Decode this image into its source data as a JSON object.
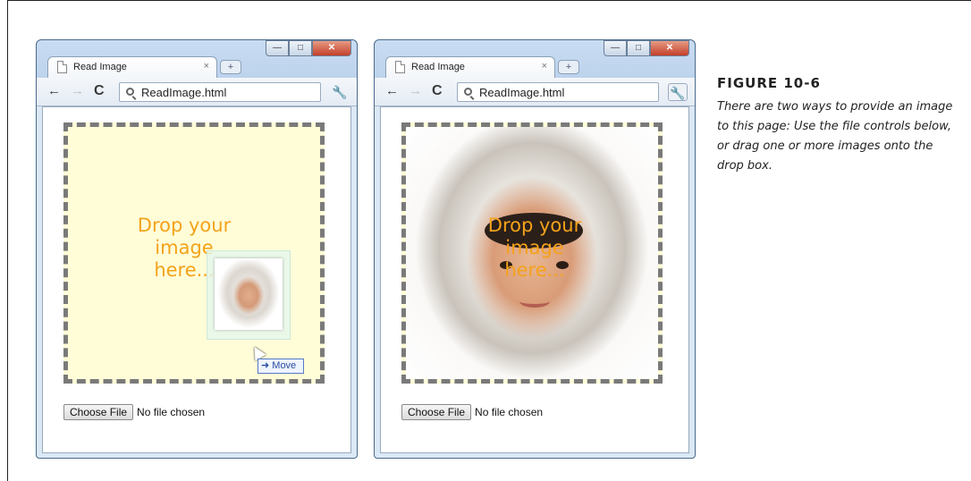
{
  "figure": {
    "label": "FIGURE 10-6",
    "caption": "There are two ways to provide an image to this page: Use the file controls below, or drag one or more images onto the drop box."
  },
  "windows": [
    {
      "tab_title": "Read Image",
      "tab_close": "×",
      "new_tab": "+",
      "address": "ReadImage.html",
      "drop_text": "Drop your\nimage\nhere...",
      "drag_badge": "Move",
      "choose_button": "Choose File",
      "file_status": "No file chosen"
    },
    {
      "tab_title": "Read Image",
      "tab_close": "×",
      "new_tab": "+",
      "address": "ReadImage.html",
      "drop_text": "Drop your\nimage\nhere...",
      "choose_button": "Choose File",
      "file_status": "No file chosen"
    }
  ],
  "icons": {
    "back": "back-arrow-icon",
    "forward": "forward-arrow-icon",
    "reload": "reload-icon",
    "search": "search-icon",
    "wrench": "wrench-icon"
  },
  "colors": {
    "drop_text": "#f4a21a",
    "dropbox_bg": "#fffdd8",
    "dropbox_border": "#7a7a7a"
  }
}
